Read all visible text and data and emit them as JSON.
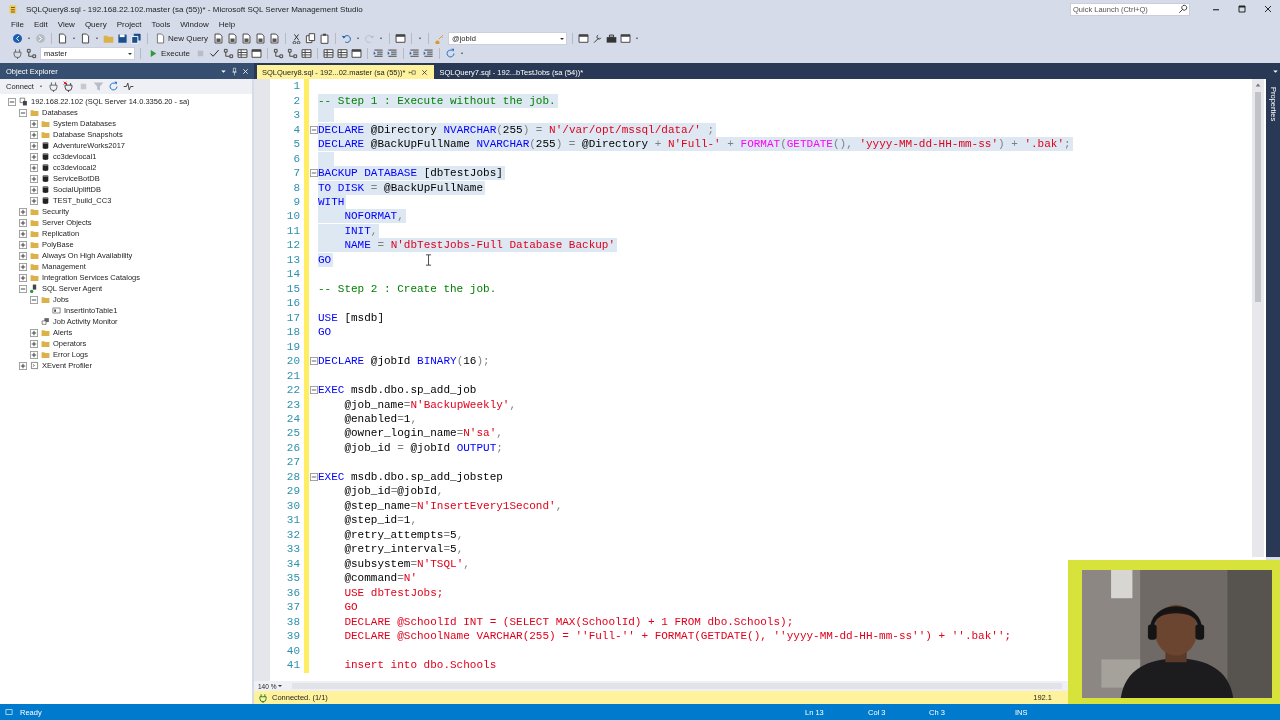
{
  "window": {
    "title": "SQLQuery8.sql - 192.168.22.102.master (sa (55))* - Microsoft SQL Server Management Studio",
    "quick_launch": {
      "placeholder": "Quick Launch (Ctrl+Q)"
    }
  },
  "menu": [
    "File",
    "Edit",
    "View",
    "Query",
    "Project",
    "Tools",
    "Window",
    "Help"
  ],
  "toolbar": {
    "new_query": "New Query",
    "search_value": "@jobId",
    "database": "master",
    "execute": "Execute"
  },
  "object_explorer": {
    "title": "Object Explorer",
    "connect": "Connect",
    "tree": [
      {
        "label": "192.168.22.102 (SQL Server 14.0.3356.20 - sa)",
        "kind": "server",
        "expanded": true,
        "children": [
          {
            "label": "Databases",
            "kind": "folder",
            "expanded": true,
            "children": [
              {
                "label": "System Databases",
                "kind": "folder",
                "expanded": false
              },
              {
                "label": "Database Snapshots",
                "kind": "folder",
                "expanded": false
              },
              {
                "label": "AdventureWorks2017",
                "kind": "db",
                "expanded": false
              },
              {
                "label": "cc3devlocal1",
                "kind": "db",
                "expanded": false
              },
              {
                "label": "cc3devlocal2",
                "kind": "db",
                "expanded": false
              },
              {
                "label": "ServiceBotDB",
                "kind": "db",
                "expanded": false
              },
              {
                "label": "SocialUpliftDB",
                "kind": "db",
                "expanded": false
              },
              {
                "label": "TEST_build_CC3",
                "kind": "db",
                "expanded": false
              }
            ]
          },
          {
            "label": "Security",
            "kind": "folder",
            "expanded": false
          },
          {
            "label": "Server Objects",
            "kind": "folder",
            "expanded": false
          },
          {
            "label": "Replication",
            "kind": "folder",
            "expanded": false
          },
          {
            "label": "PolyBase",
            "kind": "folder",
            "expanded": false
          },
          {
            "label": "Always On High Availability",
            "kind": "folder",
            "expanded": false
          },
          {
            "label": "Management",
            "kind": "folder",
            "expanded": false
          },
          {
            "label": "Integration Services Catalogs",
            "kind": "folder",
            "expanded": false
          },
          {
            "label": "SQL Server Agent",
            "kind": "agent",
            "expanded": true,
            "children": [
              {
                "label": "Jobs",
                "kind": "folder",
                "expanded": true,
                "children": [
                  {
                    "label": "InsertIntoTable1",
                    "kind": "job"
                  }
                ]
              },
              {
                "label": "Job Activity Monitor",
                "kind": "monitor"
              },
              {
                "label": "Alerts",
                "kind": "folder",
                "expanded": false
              },
              {
                "label": "Operators",
                "kind": "folder",
                "expanded": false
              },
              {
                "label": "Error Logs",
                "kind": "folder",
                "expanded": false
              }
            ]
          },
          {
            "label": "XEvent Profiler",
            "kind": "profiler",
            "expanded": false
          }
        ]
      }
    ]
  },
  "tabs": [
    {
      "label": "SQLQuery8.sql - 192...02.master (sa (55))*",
      "selected": true
    },
    {
      "label": "SQLQuery7.sql - 192...bTestJobs (sa (54))*",
      "selected": false
    }
  ],
  "properties_panel": "Properties",
  "lines": [
    {
      "n": "1",
      "fold": false,
      "selected": false
    },
    {
      "n": "2",
      "fold": false,
      "selected": true,
      "tokens": [
        {
          "kind": "comment",
          "t": "-- Step 1 : Execute without the job."
        }
      ]
    },
    {
      "n": "3",
      "fold": false,
      "selected": true
    },
    {
      "n": "4",
      "fold": true,
      "selected": true,
      "tokens": [
        {
          "kind": "keyword",
          "t": "DECLARE"
        },
        {
          "kind": "text",
          "t": " @Directory "
        },
        {
          "kind": "keyword",
          "t": "NVARCHAR"
        },
        {
          "kind": "operator",
          "t": "("
        },
        {
          "kind": "text",
          "t": "255"
        },
        {
          "kind": "operator",
          "t": ") = "
        },
        {
          "kind": "string",
          "t": "N'/var/opt/mssql/data/'"
        },
        {
          "kind": "operator",
          "t": " ;"
        }
      ]
    },
    {
      "n": "5",
      "fold": false,
      "selected": true,
      "tokens": [
        {
          "kind": "keyword",
          "t": "DECLARE"
        },
        {
          "kind": "text",
          "t": " @BackUpFullName "
        },
        {
          "kind": "keyword",
          "t": "NVARCHAR"
        },
        {
          "kind": "operator",
          "t": "("
        },
        {
          "kind": "text",
          "t": "255"
        },
        {
          "kind": "operator",
          "t": ") = "
        },
        {
          "kind": "text",
          "t": "@Directory "
        },
        {
          "kind": "operator",
          "t": "+ "
        },
        {
          "kind": "string",
          "t": "N'Full-'"
        },
        {
          "kind": "operator",
          "t": " + "
        },
        {
          "kind": "function",
          "t": "FORMAT"
        },
        {
          "kind": "operator",
          "t": "("
        },
        {
          "kind": "function",
          "t": "GETDATE"
        },
        {
          "kind": "operator",
          "t": "(), "
        },
        {
          "kind": "string",
          "t": "'yyyy-MM-dd-HH-mm-ss'"
        },
        {
          "kind": "operator",
          "t": ") + "
        },
        {
          "kind": "string",
          "t": "'.bak'"
        },
        {
          "kind": "operator",
          "t": ";"
        }
      ]
    },
    {
      "n": "6",
      "fold": false,
      "selected": true
    },
    {
      "n": "7",
      "fold": true,
      "selected": true,
      "tokens": [
        {
          "kind": "keyword",
          "t": "BACKUP DATABASE"
        },
        {
          "kind": "text",
          "t": " [dbTestJobs]"
        }
      ]
    },
    {
      "n": "8",
      "fold": false,
      "selected": true,
      "tokens": [
        {
          "kind": "keyword",
          "t": "TO DISK"
        },
        {
          "kind": "operator",
          "t": " = "
        },
        {
          "kind": "text",
          "t": "@BackUpFullName"
        }
      ]
    },
    {
      "n": "9",
      "fold": false,
      "selected": true,
      "tokens": [
        {
          "kind": "keyword",
          "t": "WITH"
        }
      ]
    },
    {
      "n": "10",
      "fold": false,
      "selected": true,
      "tokens": [
        {
          "kind": "keyword",
          "t": "    NOFORMAT"
        },
        {
          "kind": "operator",
          "t": ","
        }
      ]
    },
    {
      "n": "11",
      "fold": false,
      "selected": true,
      "tokens": [
        {
          "kind": "keyword",
          "t": "    INIT"
        },
        {
          "kind": "operator",
          "t": ","
        }
      ]
    },
    {
      "n": "12",
      "fold": false,
      "selected": true,
      "tokens": [
        {
          "kind": "keyword",
          "t": "    NAME"
        },
        {
          "kind": "operator",
          "t": " = "
        },
        {
          "kind": "string",
          "t": "N'dbTestJobs-Full Database Backup'"
        }
      ]
    },
    {
      "n": "13",
      "fold": false,
      "selected": true,
      "tokens": [
        {
          "kind": "keyword",
          "t": "GO"
        }
      ]
    },
    {
      "n": "14",
      "fold": false,
      "selected": false
    },
    {
      "n": "15",
      "fold": false,
      "selected": false,
      "tokens": [
        {
          "kind": "comment",
          "t": "-- Step 2 : Create the job."
        }
      ]
    },
    {
      "n": "16",
      "fold": false,
      "selected": false
    },
    {
      "n": "17",
      "fold": false,
      "selected": false,
      "tokens": [
        {
          "kind": "keyword",
          "t": "USE"
        },
        {
          "kind": "text",
          "t": " [msdb]"
        }
      ]
    },
    {
      "n": "18",
      "fold": false,
      "selected": false,
      "tokens": [
        {
          "kind": "keyword",
          "t": "GO"
        }
      ]
    },
    {
      "n": "19",
      "fold": false,
      "selected": false
    },
    {
      "n": "20",
      "fold": true,
      "selected": false,
      "tokens": [
        {
          "kind": "keyword",
          "t": "DECLARE"
        },
        {
          "kind": "text",
          "t": " @jobId "
        },
        {
          "kind": "keyword",
          "t": "BINARY"
        },
        {
          "kind": "operator",
          "t": "("
        },
        {
          "kind": "text",
          "t": "16"
        },
        {
          "kind": "operator",
          "t": ");"
        }
      ]
    },
    {
      "n": "21",
      "fold": false,
      "selected": false
    },
    {
      "n": "22",
      "fold": true,
      "selected": false,
      "tokens": [
        {
          "kind": "keyword",
          "t": "EXEC"
        },
        {
          "kind": "text",
          "t": " msdb.dbo.sp_add_job"
        }
      ]
    },
    {
      "n": "23",
      "fold": false,
      "selected": false,
      "tokens": [
        {
          "kind": "text",
          "t": "    @job_name"
        },
        {
          "kind": "operator",
          "t": "="
        },
        {
          "kind": "string",
          "t": "N'BackupWeekly'"
        },
        {
          "kind": "operator",
          "t": ","
        }
      ]
    },
    {
      "n": "24",
      "fold": false,
      "selected": false,
      "tokens": [
        {
          "kind": "text",
          "t": "    @enabled"
        },
        {
          "kind": "operator",
          "t": "="
        },
        {
          "kind": "text",
          "t": "1"
        },
        {
          "kind": "operator",
          "t": ","
        }
      ]
    },
    {
      "n": "25",
      "fold": false,
      "selected": false,
      "tokens": [
        {
          "kind": "text",
          "t": "    @owner_login_name"
        },
        {
          "kind": "operator",
          "t": "="
        },
        {
          "kind": "string",
          "t": "N'sa'"
        },
        {
          "kind": "operator",
          "t": ","
        }
      ]
    },
    {
      "n": "26",
      "fold": false,
      "selected": false,
      "tokens": [
        {
          "kind": "text",
          "t": "    @job_id "
        },
        {
          "kind": "operator",
          "t": "="
        },
        {
          "kind": "text",
          "t": " @jobId "
        },
        {
          "kind": "keyword",
          "t": "OUTPUT"
        },
        {
          "kind": "operator",
          "t": ";"
        }
      ]
    },
    {
      "n": "27",
      "fold": false,
      "selected": false
    },
    {
      "n": "28",
      "fold": true,
      "selected": false,
      "tokens": [
        {
          "kind": "keyword",
          "t": "EXEC"
        },
        {
          "kind": "text",
          "t": " msdb.dbo.sp_add_jobstep"
        }
      ]
    },
    {
      "n": "29",
      "fold": false,
      "selected": false,
      "tokens": [
        {
          "kind": "text",
          "t": "    @job_id"
        },
        {
          "kind": "operator",
          "t": "="
        },
        {
          "kind": "text",
          "t": "@jobId"
        },
        {
          "kind": "operator",
          "t": ","
        }
      ]
    },
    {
      "n": "30",
      "fold": false,
      "selected": false,
      "tokens": [
        {
          "kind": "text",
          "t": "    @step_name"
        },
        {
          "kind": "operator",
          "t": "="
        },
        {
          "kind": "string",
          "t": "N'InsertEvery1Second'"
        },
        {
          "kind": "operator",
          "t": ","
        }
      ]
    },
    {
      "n": "31",
      "fold": false,
      "selected": false,
      "tokens": [
        {
          "kind": "text",
          "t": "    @step_id"
        },
        {
          "kind": "operator",
          "t": "="
        },
        {
          "kind": "text",
          "t": "1"
        },
        {
          "kind": "operator",
          "t": ","
        }
      ]
    },
    {
      "n": "32",
      "fold": false,
      "selected": false,
      "tokens": [
        {
          "kind": "text",
          "t": "    @retry_attempts"
        },
        {
          "kind": "operator",
          "t": "="
        },
        {
          "kind": "text",
          "t": "5"
        },
        {
          "kind": "operator",
          "t": ","
        }
      ]
    },
    {
      "n": "33",
      "fold": false,
      "selected": false,
      "tokens": [
        {
          "kind": "text",
          "t": "    @retry_interval"
        },
        {
          "kind": "operator",
          "t": "="
        },
        {
          "kind": "text",
          "t": "5"
        },
        {
          "kind": "operator",
          "t": ","
        }
      ]
    },
    {
      "n": "34",
      "fold": false,
      "selected": false,
      "tokens": [
        {
          "kind": "text",
          "t": "    @subsystem"
        },
        {
          "kind": "operator",
          "t": "="
        },
        {
          "kind": "string",
          "t": "N'TSQL'"
        },
        {
          "kind": "operator",
          "t": ","
        }
      ]
    },
    {
      "n": "35",
      "fold": false,
      "selected": false,
      "tokens": [
        {
          "kind": "text",
          "t": "    @command"
        },
        {
          "kind": "operator",
          "t": "="
        },
        {
          "kind": "string",
          "t": "N'"
        }
      ]
    },
    {
      "n": "36",
      "fold": false,
      "selected": false,
      "tokens": [
        {
          "kind": "string",
          "t": "    USE dbTestJobs;"
        }
      ]
    },
    {
      "n": "37",
      "fold": false,
      "selected": false,
      "tokens": [
        {
          "kind": "string",
          "t": "    GO"
        }
      ]
    },
    {
      "n": "38",
      "fold": false,
      "selected": false,
      "tokens": [
        {
          "kind": "string",
          "t": "    DECLARE @SchoolId INT = (SELECT MAX(SchoolId) + 1 FROM dbo.Schools);"
        }
      ]
    },
    {
      "n": "39",
      "fold": false,
      "selected": false,
      "tokens": [
        {
          "kind": "string",
          "t": "    DECLARE @SchoolName VARCHAR(255) = ''Full-'' + FORMAT(GETDATE(), ''yyyy-MM-dd-HH-mm-ss'') + ''.bak'';"
        }
      ]
    },
    {
      "n": "40",
      "fold": false,
      "selected": false
    },
    {
      "n": "41",
      "fold": false,
      "selected": false,
      "tokens": [
        {
          "kind": "string",
          "t": "    insert into dbo.Schools"
        }
      ]
    }
  ],
  "editor_footer": {
    "zoom": "140 %",
    "connection": "Connected. (1/1)",
    "server": "192.1"
  },
  "status_bar": {
    "text": "Ready",
    "line": "Ln 13",
    "column": "Col 3",
    "char": "Ch 3",
    "mode": "INS"
  }
}
